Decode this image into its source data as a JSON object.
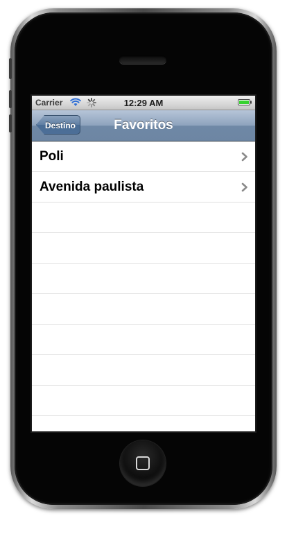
{
  "status_bar": {
    "carrier": "Carrier",
    "time": "12:29 AM",
    "icons": [
      "wifi-icon",
      "activity-indicator-icon",
      "battery-icon"
    ]
  },
  "nav_bar": {
    "back_label": "Destino",
    "title": "Favoritos"
  },
  "favorites": [
    {
      "label": "Poli"
    },
    {
      "label": "Avenida paulista"
    }
  ],
  "colors": {
    "nav_bar": "#7990ad",
    "battery": "#37d22f",
    "wifi": "#2f6fd6"
  }
}
